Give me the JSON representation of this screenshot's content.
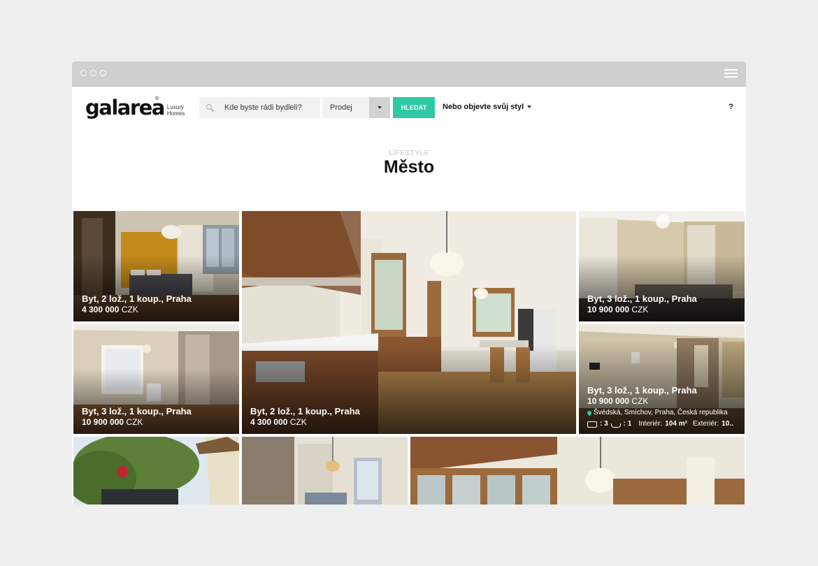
{
  "header": {
    "logo_text": "galarea",
    "logo_reg": "®",
    "logo_sub_line1": "Luxury",
    "logo_sub_line2": "Homes",
    "search_placeholder": "Kde byste rádi bydleli?",
    "select_value": "Prodej",
    "search_button_label": "HLEDAT",
    "style_dropdown_label": "Nebo objevte svůj styl",
    "help_label": "?"
  },
  "hero": {
    "eyebrow": "LIFESTYLE",
    "title": "Město"
  },
  "listings": [
    {
      "title": "Byt, 2 lož., 1 koup., Praha",
      "price": "4 300 000",
      "currency": "CZK"
    },
    {
      "title": "Byt, 2 lož., 1 koup., Praha",
      "price": "4 300 000",
      "currency": "CZK"
    },
    {
      "title": "Byt, 3 lož., 1 koup., Praha",
      "price": "10 900 000",
      "currency": "CZK"
    },
    {
      "title": "Byt, 3 lož., 1 koup., Praha",
      "price": "10 900 000",
      "currency": "CZK"
    },
    {
      "title": "Byt, 3 lož., 1 koup., Praha",
      "price": "10 900 000",
      "currency": "CZK",
      "address": "Švédská, Smíchov, Praha, Česká republika",
      "bedrooms": ": 3",
      "bathrooms": ": 1",
      "interior_label": "Interiér:",
      "interior_value": "104 m²",
      "exterior_label": "Exteriér:",
      "exterior_value": "10.."
    }
  ],
  "colors": {
    "accent": "#2fc9a4",
    "chrome": "#cfcfcf",
    "background": "#efefef"
  }
}
